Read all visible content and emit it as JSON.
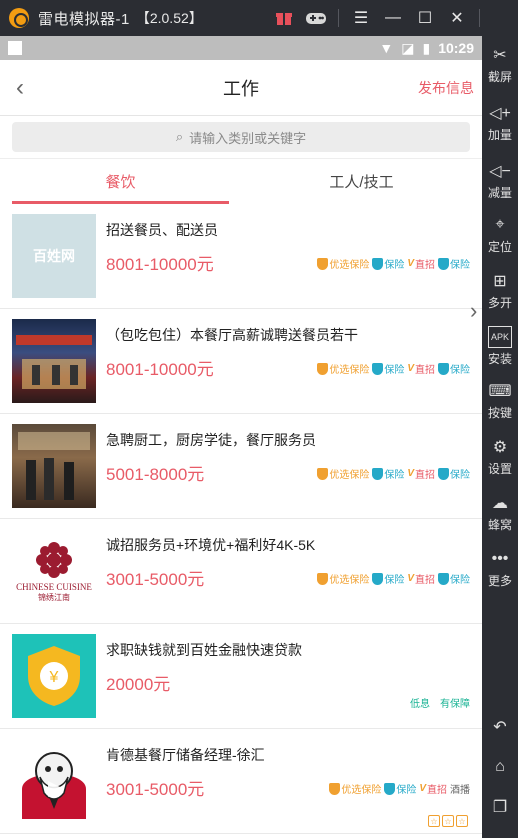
{
  "emulator": {
    "title": "雷电模拟器-1",
    "version": "【2.0.52】",
    "tools": [
      "gift-icon",
      "gamepad-icon",
      "menu-icon",
      "minimize-icon",
      "maximize-icon",
      "close-icon"
    ],
    "collapse_icon": "double-chevron-left-icon"
  },
  "statusbar": {
    "time": "10:29"
  },
  "appbar": {
    "title": "工作",
    "publish": "发布信息"
  },
  "search": {
    "placeholder": "请输入类别或关键字"
  },
  "tabs": [
    {
      "label": "餐饮",
      "active": true
    },
    {
      "label": "工人/技工",
      "active": false
    }
  ],
  "jobs": [
    {
      "title": "招送餐员、配送员",
      "salary": "8001-10000元",
      "thumb_text": "百姓网",
      "badges": [
        "优选保险",
        "保险",
        "直招",
        "保险"
      ]
    },
    {
      "title": "（包吃包住）本餐厅高薪诚聘送餐员若干",
      "salary": "8001-10000元",
      "badges": [
        "优选保险",
        "保险",
        "直招",
        "保险"
      ]
    },
    {
      "title": "急聘厨工，厨房学徒，餐厅服务员",
      "salary": "5001-8000元",
      "badges": [
        "优选保险",
        "保险",
        "直招",
        "保险"
      ]
    },
    {
      "title": "诚招服务员+环境优+福利好4K-5K",
      "salary": "3001-5000元",
      "thumb_text": "CHINESE CUISINE",
      "thumb_sub": "锦绣江南",
      "badges": [
        "优选保险",
        "保险",
        "直招",
        "保险"
      ]
    },
    {
      "title": "求职缺钱就到百姓金融快速贷款",
      "salary": "20000元",
      "small_badges": [
        "低息",
        "有保障"
      ]
    },
    {
      "title": "肯德基餐厅储备经理-徐汇",
      "salary": "3001-5000元",
      "badges": [
        "优选保险",
        "保险",
        "直招",
        "酒播"
      ]
    }
  ],
  "sidebar": [
    {
      "icon": "scissors-icon",
      "label": "截屏"
    },
    {
      "icon": "volume-up-icon",
      "label": "加量"
    },
    {
      "icon": "volume-down-icon",
      "label": "减量"
    },
    {
      "icon": "location-icon",
      "label": "定位"
    },
    {
      "icon": "multi-window-icon",
      "label": "多开"
    },
    {
      "icon": "apk-icon",
      "label": "安装"
    },
    {
      "icon": "keyboard-icon",
      "label": "按键"
    },
    {
      "icon": "gear-icon",
      "label": "设置"
    },
    {
      "icon": "hive-icon",
      "label": "蜂窝"
    },
    {
      "icon": "more-icon",
      "label": "更多"
    },
    {
      "icon": "back-icon",
      "label": ""
    },
    {
      "icon": "home-icon",
      "label": ""
    },
    {
      "icon": "recent-icon",
      "label": ""
    }
  ],
  "colors": {
    "accent": "#e85b67",
    "teal": "#25a9c8",
    "orange": "#f0a030",
    "chrome": "#2b2d33"
  }
}
